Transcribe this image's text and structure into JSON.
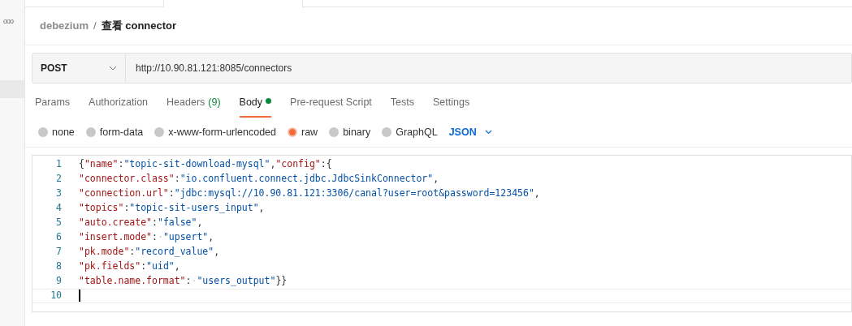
{
  "sidebar": {
    "more": "ooo"
  },
  "breadcrumb": {
    "collection": "debezium",
    "separator": "/",
    "request": "查看 connector"
  },
  "request": {
    "method": "POST",
    "url": "http://10.90.81.121:8085/connectors"
  },
  "tabs": [
    {
      "label": "Params",
      "selected": false
    },
    {
      "label": "Authorization",
      "selected": false
    },
    {
      "label": "Headers",
      "count": "(9)",
      "selected": false
    },
    {
      "label": "Body",
      "dot": true,
      "selected": true
    },
    {
      "label": "Pre-request Script",
      "selected": false
    },
    {
      "label": "Tests",
      "selected": false
    },
    {
      "label": "Settings",
      "selected": false
    }
  ],
  "body_types": [
    {
      "label": "none",
      "selected": false
    },
    {
      "label": "form-data",
      "selected": false
    },
    {
      "label": "x-www-form-urlencoded",
      "selected": false
    },
    {
      "label": "raw",
      "selected": true
    },
    {
      "label": "binary",
      "selected": false
    },
    {
      "label": "GraphQL",
      "selected": false
    }
  ],
  "format": "JSON",
  "editor": {
    "lines": [
      {
        "number": "1",
        "tokens": [
          {
            "kind": "punct",
            "text": "{"
          },
          {
            "kind": "key",
            "text": "\"name\""
          },
          {
            "kind": "punct",
            "text": ":"
          },
          {
            "kind": "str",
            "text": "\"topic-sit-download-mysql\""
          },
          {
            "kind": "punct",
            "text": ","
          },
          {
            "kind": "key",
            "text": "\"config\""
          },
          {
            "kind": "punct",
            "text": ":{"
          }
        ]
      },
      {
        "number": "2",
        "tokens": [
          {
            "kind": "key",
            "text": "\"connector.class\""
          },
          {
            "kind": "punct",
            "text": ":"
          },
          {
            "kind": "str",
            "text": "\"io.confluent.connect.jdbc.JdbcSinkConnector\""
          },
          {
            "kind": "punct",
            "text": ","
          }
        ]
      },
      {
        "number": "3",
        "tokens": [
          {
            "kind": "key",
            "text": "\"connection.url\""
          },
          {
            "kind": "punct",
            "text": ":"
          },
          {
            "kind": "str",
            "text": "\"jdbc:mysql://10.90.81.121:3306/canal?user=root&password=123456\""
          },
          {
            "kind": "punct",
            "text": ","
          }
        ]
      },
      {
        "number": "4",
        "tokens": [
          {
            "kind": "key",
            "text": "\"topics\""
          },
          {
            "kind": "punct",
            "text": ":"
          },
          {
            "kind": "str",
            "text": "\"topic-sit-users_input\""
          },
          {
            "kind": "punct",
            "text": ","
          }
        ]
      },
      {
        "number": "5",
        "tokens": [
          {
            "kind": "key",
            "text": "\"auto.create\""
          },
          {
            "kind": "punct",
            "text": ":"
          },
          {
            "kind": "str",
            "text": "\"false\""
          },
          {
            "kind": "punct",
            "text": ","
          }
        ]
      },
      {
        "number": "6",
        "tokens": [
          {
            "kind": "key",
            "text": "\"insert.mode\""
          },
          {
            "kind": "punct",
            "text": ":"
          },
          {
            "kind": "ws",
            "text": "·"
          },
          {
            "kind": "str",
            "text": "\"upsert\""
          },
          {
            "kind": "punct",
            "text": ","
          }
        ]
      },
      {
        "number": "7",
        "tokens": [
          {
            "kind": "key",
            "text": "\"pk.mode\""
          },
          {
            "kind": "punct",
            "text": ":"
          },
          {
            "kind": "str",
            "text": "\"record_value\""
          },
          {
            "kind": "punct",
            "text": ","
          }
        ]
      },
      {
        "number": "8",
        "tokens": [
          {
            "kind": "key",
            "text": "\"pk.fields\""
          },
          {
            "kind": "punct",
            "text": ":"
          },
          {
            "kind": "str",
            "text": "\"uid\""
          },
          {
            "kind": "punct",
            "text": ","
          }
        ]
      },
      {
        "number": "9",
        "tokens": [
          {
            "kind": "key",
            "text": "\"table.name.format\""
          },
          {
            "kind": "punct",
            "text": ":"
          },
          {
            "kind": "ws",
            "text": "·"
          },
          {
            "kind": "str",
            "text": "\"users_output\""
          },
          {
            "kind": "punct",
            "text": "}}"
          }
        ]
      },
      {
        "number": "10",
        "current": true
      }
    ]
  }
}
